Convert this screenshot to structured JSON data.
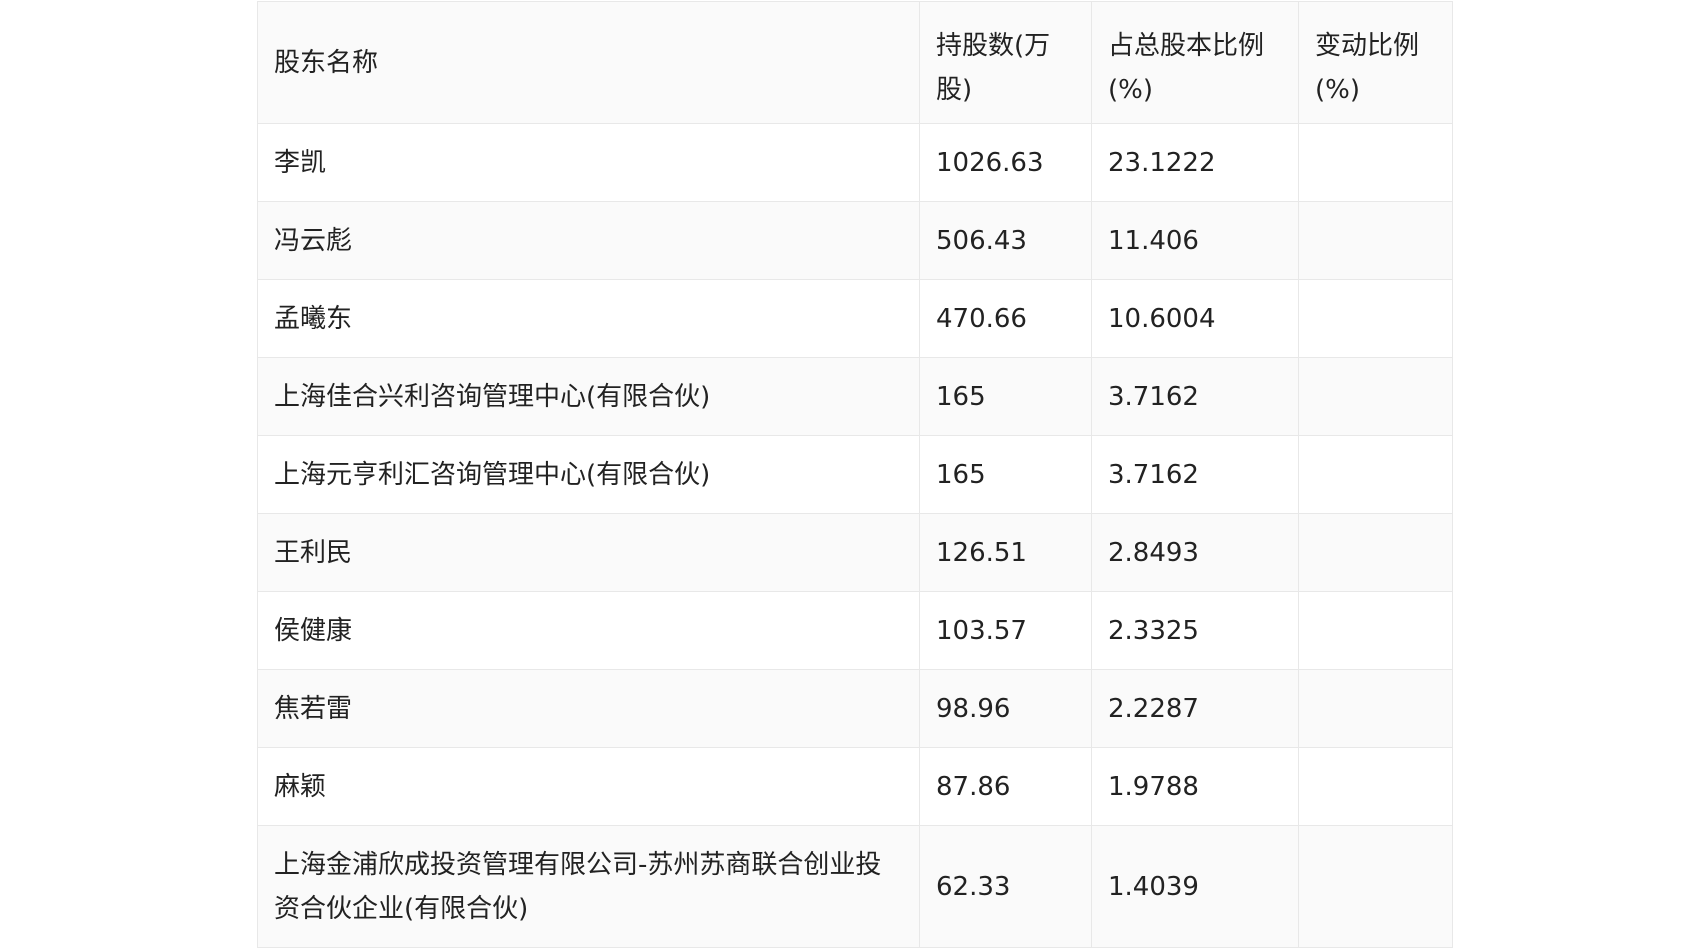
{
  "table": {
    "headers": [
      "股东名称",
      "持股数(万股)",
      "占总股本比例(%)",
      "变动比例(%)"
    ],
    "rows": [
      [
        "李凯",
        "1026.63",
        "23.1222",
        ""
      ],
      [
        "冯云彪",
        "506.43",
        "11.406",
        ""
      ],
      [
        "孟曦东",
        "470.66",
        "10.6004",
        ""
      ],
      [
        "上海佳合兴利咨询管理中心(有限合伙)",
        "165",
        "3.7162",
        ""
      ],
      [
        "上海元亨利汇咨询管理中心(有限合伙)",
        "165",
        "3.7162",
        ""
      ],
      [
        "王利民",
        "126.51",
        "2.8493",
        ""
      ],
      [
        "侯健康",
        "103.57",
        "2.3325",
        ""
      ],
      [
        "焦若雷",
        "98.96",
        "2.2287",
        ""
      ],
      [
        "麻颖",
        "87.86",
        "1.9788",
        ""
      ],
      [
        "上海金浦欣成投资管理有限公司-苏州苏商联合创业投资合伙企业(有限合伙)",
        "62.33",
        "1.4039",
        ""
      ]
    ]
  }
}
